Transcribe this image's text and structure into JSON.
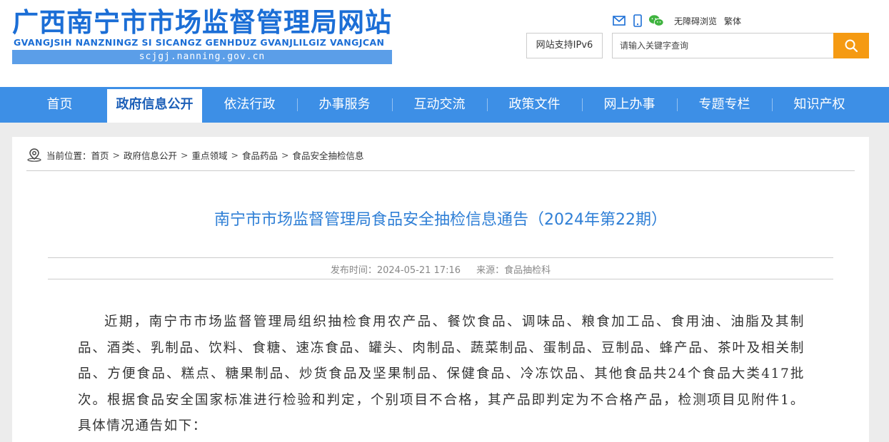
{
  "header": {
    "title": "广西南宁市市场监督管理局网站",
    "pinyin": "GVANGJSIH NANZNINGZ SI SICANGZ GENHDUZ GVANJLILGIZ VANGJCAN",
    "domain": "scjgj.nanning.gov.cn",
    "tools": {
      "accessible": "无障碍浏览",
      "traditional": "繁体"
    },
    "ipv6": "网站支持IPv6",
    "search_placeholder": "请输入关键字查询"
  },
  "nav": {
    "items": [
      {
        "label": "首页"
      },
      {
        "label": "政府信息公开"
      },
      {
        "label": "依法行政"
      },
      {
        "label": "办事服务"
      },
      {
        "label": "互动交流"
      },
      {
        "label": "政策文件"
      },
      {
        "label": "网上办事"
      },
      {
        "label": "专题专栏"
      },
      {
        "label": "知识产权"
      }
    ]
  },
  "breadcrumb": {
    "prefix": "当前位置：",
    "items": [
      "首页",
      "政府信息公开",
      "重点领域",
      "食品药品",
      "食品安全抽检信息"
    ]
  },
  "article": {
    "title": "南宁市市场监督管理局食品安全抽检信息通告（2024年第22期）",
    "publish": "发布时间：2024-05-21 17:16",
    "source": "来源：食品抽检科",
    "paragraph": "近期，南宁市市场监督管理局组织抽检食用农产品、餐饮食品、调味品、粮食加工品、食用油、油脂及其制品、酒类、乳制品、饮料、食糖、速冻食品、罐头、肉制品、蔬菜制品、蛋制品、豆制品、蜂产品、茶叶及相关制品、方便食品、糕点、糖果制品、炒货食品及坚果制品、保健食品、冷冻饮品、其他食品共24个食品大类417批次。根据食品安全国家标准进行检验和判定，个别项目不合格，其产品即判定为不合格产品，检测项目见附件1。具体情况通告如下："
  },
  "colors": {
    "brand": "#1b6ed6",
    "nav": "#3d8fe6",
    "search_button": "#f59a12",
    "title": "#2f7fd6"
  },
  "icons": [
    "mail-icon",
    "mobile-icon",
    "wechat-icon",
    "search-icon",
    "location-icon"
  ]
}
